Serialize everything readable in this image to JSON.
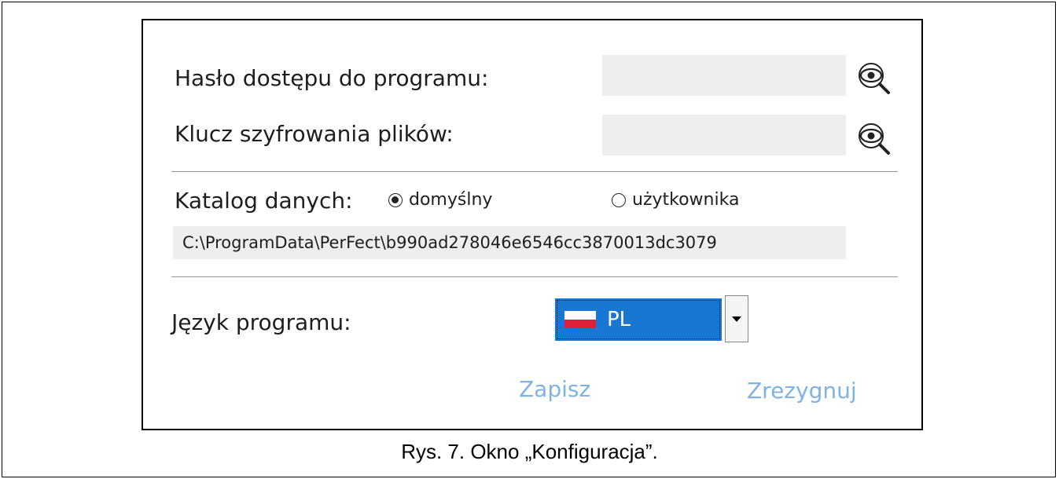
{
  "dialog": {
    "password_label": "Hasło dostępu do programu:",
    "password_value": "",
    "encryption_label": "Klucz szyfrowania plików:",
    "encryption_value": "",
    "show_icon": "eye-magnifier-icon",
    "data_dir": {
      "label": "Katalog danych:",
      "option_default": "domyślny",
      "option_user": "użytkownika",
      "selected": "domyślny",
      "path": "C:\\ProgramData\\PerFect\\b990ad278046e6546cc3870013dc3079"
    },
    "language": {
      "label": "Język programu:",
      "selected": "PL",
      "flag_icon": "poland-flag-icon"
    },
    "buttons": {
      "save": "Zapisz",
      "cancel": "Zrezygnuj"
    }
  },
  "caption": "Rys. 7. Okno „Konfiguracja”.",
  "colors": {
    "field_bg": "#eeeeee",
    "select_bg": "#1877d2",
    "button_text": "#7fb2e5"
  }
}
